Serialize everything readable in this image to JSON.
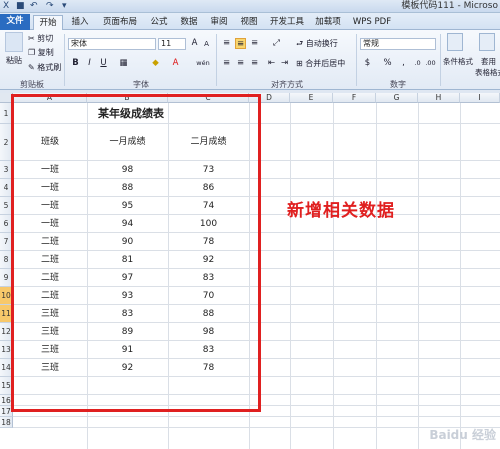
{
  "window": {
    "title": "模板代码111 - Microso",
    "quick_access": [
      "■",
      "↶",
      "↷",
      "▾"
    ]
  },
  "tabs": [
    {
      "label": "文件",
      "kind": "file"
    },
    {
      "label": "开始",
      "kind": "active"
    },
    {
      "label": "插入"
    },
    {
      "label": "页面布局"
    },
    {
      "label": "公式"
    },
    {
      "label": "数据"
    },
    {
      "label": "审阅"
    },
    {
      "label": "视图"
    },
    {
      "label": "开发工具"
    },
    {
      "label": "加载项"
    },
    {
      "label": "WPS PDF"
    }
  ],
  "ribbon": {
    "clipboard": {
      "paste": "粘贴",
      "cut": "剪切",
      "copy": "复制",
      "format_painter": "格式刷",
      "label": "剪贴板"
    },
    "font": {
      "name": "宋体",
      "size": "11",
      "grow": "A",
      "shrink": "A",
      "bold": "B",
      "italic": "I",
      "underline": "U",
      "label": "字体",
      "wen": "wén"
    },
    "alignment": {
      "wrap": "自动换行",
      "merge": "合并后居中",
      "label": "对齐方式"
    },
    "number": {
      "format": "常规",
      "percent": "%",
      "comma": ",",
      "label": "数字"
    },
    "styles": {
      "conditional": "条件格式",
      "table_format": "套用",
      "table_format2": "表格格式"
    }
  },
  "columns": [
    "A",
    "B",
    "C",
    "D",
    "E",
    "F",
    "G",
    "H",
    "I"
  ],
  "rows": [
    "1",
    "2",
    "3",
    "4",
    "5",
    "6",
    "7",
    "8",
    "9",
    "10",
    "11",
    "12",
    "13",
    "14",
    "15",
    "16",
    "17",
    "18"
  ],
  "sheet": {
    "title": "某年级成绩表",
    "headers": [
      "班级",
      "一月成绩",
      "二月成绩"
    ],
    "data": [
      [
        "一班",
        "98",
        "73"
      ],
      [
        "一班",
        "88",
        "86"
      ],
      [
        "一班",
        "95",
        "74"
      ],
      [
        "一班",
        "94",
        "100"
      ],
      [
        "二班",
        "90",
        "78"
      ],
      [
        "二班",
        "81",
        "92"
      ],
      [
        "二班",
        "97",
        "83"
      ],
      [
        "二班",
        "93",
        "70"
      ],
      [
        "三班",
        "83",
        "88"
      ],
      [
        "三班",
        "89",
        "98"
      ],
      [
        "三班",
        "91",
        "83"
      ],
      [
        "三班",
        "92",
        "78"
      ]
    ]
  },
  "annotation": "新增相关数据",
  "watermark": "Baidu 经验",
  "colors": {
    "accent": "#e02020",
    "ribbon": "#dfe9f5",
    "file_tab": "#2a6cc1"
  }
}
